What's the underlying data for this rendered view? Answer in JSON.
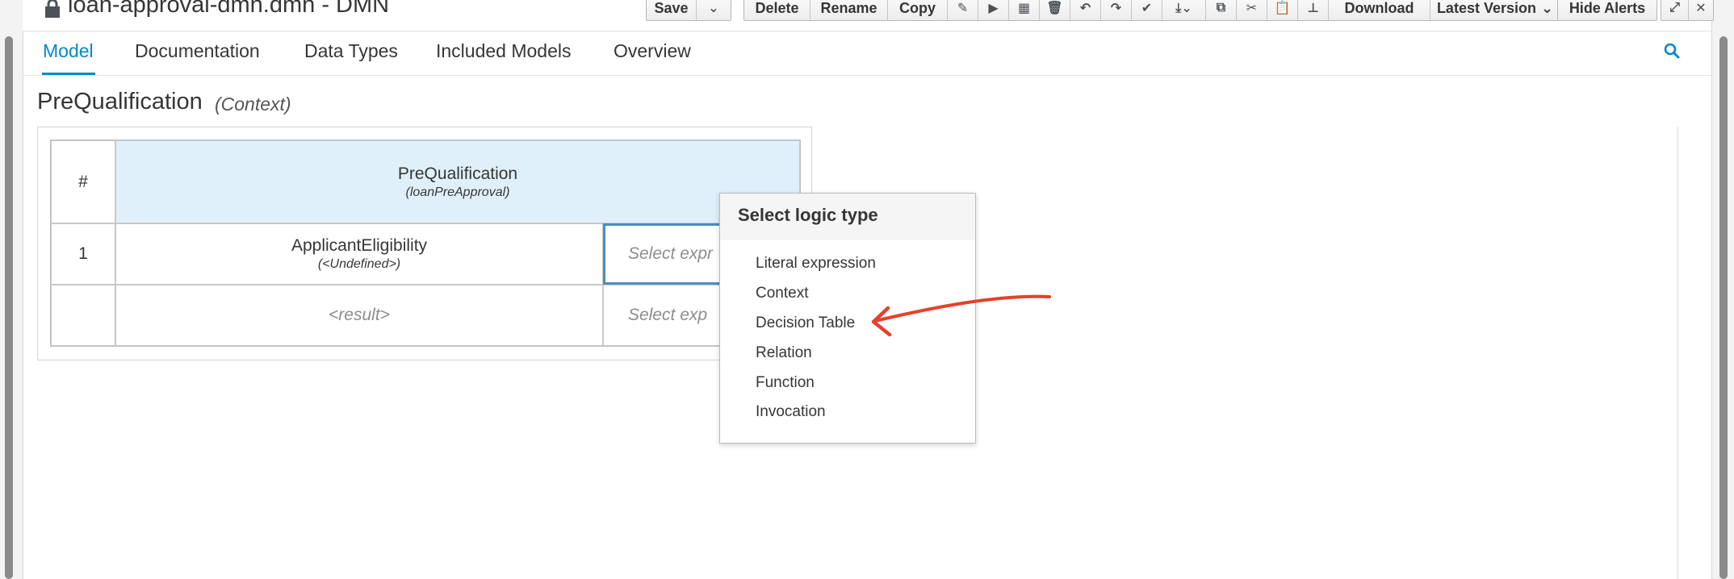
{
  "header": {
    "title": "loan-approval-dmn.dmn - DMN",
    "toolbar": {
      "save_label": "Save",
      "delete_label": "Delete",
      "rename_label": "Rename",
      "copy_label": "Copy",
      "download_label": "Download",
      "latest_version_label": "Latest Version",
      "hide_alerts_label": "Hide Alerts"
    }
  },
  "tabs": [
    {
      "label": "Model",
      "active": true
    },
    {
      "label": "Documentation",
      "active": false
    },
    {
      "label": "Data Types",
      "active": false
    },
    {
      "label": "Included Models",
      "active": false
    },
    {
      "label": "Overview",
      "active": false
    }
  ],
  "expression": {
    "name": "PreQualification",
    "type": "(Context)"
  },
  "grid": {
    "row_header": "#",
    "column_name": "PreQualification",
    "column_type": "(loanPreApproval)",
    "rows": [
      {
        "number": "1",
        "name": "ApplicantEligibility",
        "type": "(<Undefined>)",
        "expression": "Select expr"
      },
      {
        "number": "",
        "name": "<result>",
        "type": "",
        "expression": "Select exp"
      }
    ]
  },
  "popover": {
    "title": "Select logic type",
    "items": [
      "Literal expression",
      "Context",
      "Decision Table",
      "Relation",
      "Function",
      "Invocation"
    ]
  },
  "colors": {
    "accent": "#0088ce",
    "header_cell_bg": "#dff0fb",
    "annotation_arrow": "#e8402a"
  }
}
